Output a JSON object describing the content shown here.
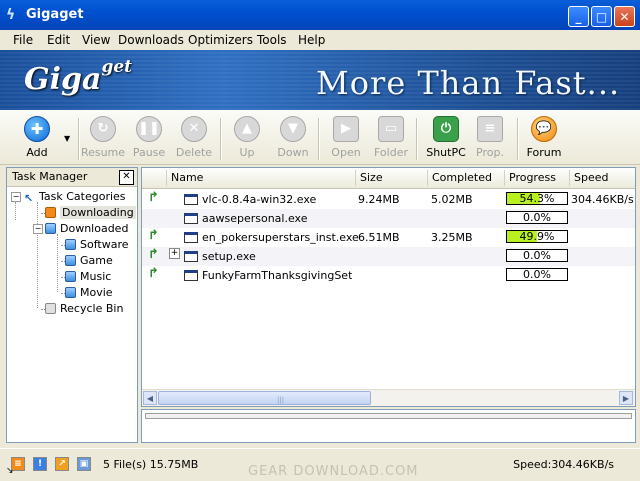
{
  "window": {
    "title": "Gigaget",
    "icon": "gigaget-app-icon"
  },
  "menu": [
    "File",
    "Edit",
    "View",
    "Downloads",
    "Optimizers",
    "Tools",
    "Help"
  ],
  "banner": {
    "logo_main": "Giga",
    "logo_sup": "get",
    "slogan": "More Than Fast..."
  },
  "toolbar": {
    "add": "Add",
    "resume": "Resume",
    "pause": "Pause",
    "delete": "Delete",
    "up": "Up",
    "down": "Down",
    "open": "Open",
    "folder": "Folder",
    "shutpc": "ShutPC",
    "prop": "Prop.",
    "forum": "Forum"
  },
  "task_manager": {
    "title": "Task Manager",
    "close": "✕",
    "root": "Task Categories",
    "downloading": "Downloading",
    "downloaded": "Downloaded",
    "children": [
      "Software",
      "Game",
      "Music",
      "Movie"
    ],
    "recycle": "Recycle Bin"
  },
  "columns": [
    "Name",
    "Size",
    "Completed",
    "Progress",
    "Speed"
  ],
  "rows": [
    {
      "name": "vlc-0.8.4a-win32.exe",
      "size": "9.24MB",
      "completed": "5.02MB",
      "progress": "54.3%",
      "progress_value": 54.3,
      "speed": "304.46KB/s",
      "expand": ""
    },
    {
      "name": "aawsepersonal.exe",
      "size": "",
      "completed": "",
      "progress": "0.0%",
      "progress_value": 0,
      "speed": "",
      "expand": ""
    },
    {
      "name": "en_pokersuperstars_inst.exe",
      "size": "6.51MB",
      "completed": "3.25MB",
      "progress": "49.9%",
      "progress_value": 49.9,
      "speed": "",
      "expand": ""
    },
    {
      "name": "setup.exe",
      "size": "",
      "completed": "",
      "progress": "0.0%",
      "progress_value": 0,
      "speed": "",
      "expand": "+"
    },
    {
      "name": "FunkyFarmThanksgivingSetup.e",
      "size": "",
      "completed": "",
      "progress": "0.0%",
      "progress_value": 0,
      "speed": "",
      "expand": ""
    }
  ],
  "status": {
    "files": "5 File(s) 15.75MB",
    "speed": "Speed:304.46KB/s",
    "watermark": "GEAR DOWNLOAD.COM"
  },
  "colors": {
    "title_bar": "#0050d0",
    "progress_fill": "#b8f020",
    "banner": "#2f6fc2"
  }
}
